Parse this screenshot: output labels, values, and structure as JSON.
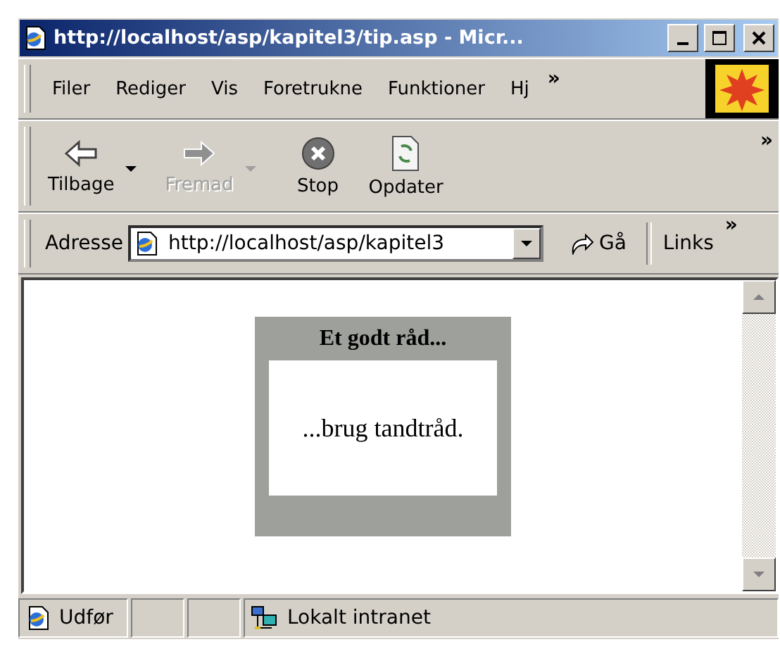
{
  "window": {
    "title": "http://localhost/asp/kapitel3/tip.asp - Micr..."
  },
  "menu": [
    {
      "label": "Filer"
    },
    {
      "label": "Rediger"
    },
    {
      "label": "Vis"
    },
    {
      "label": "Foretrukne"
    },
    {
      "label": "Funktioner"
    },
    {
      "label": "Hj"
    }
  ],
  "menu_overflow": "»",
  "toolbar": [
    {
      "kind": "back",
      "label": "Tilbage",
      "disabled": false,
      "dropdown": true
    },
    {
      "kind": "forward",
      "label": "Fremad",
      "disabled": true,
      "dropdown": true
    },
    {
      "kind": "stop",
      "label": "Stop",
      "disabled": false,
      "dropdown": false
    },
    {
      "kind": "refresh",
      "label": "Opdater",
      "disabled": false,
      "dropdown": false
    }
  ],
  "toolbar_overflow": "»",
  "address_bar": {
    "label": "Adresse",
    "value": "http://localhost/asp/kapitel3",
    "go": "Gå",
    "links": "Links",
    "links_overflow": "»"
  },
  "page": {
    "tip_title": "Et godt råd...",
    "tip_text": "...brug tandtråd."
  },
  "status_bar": {
    "text": "Udfør",
    "zone": "Lokalt intranet"
  }
}
